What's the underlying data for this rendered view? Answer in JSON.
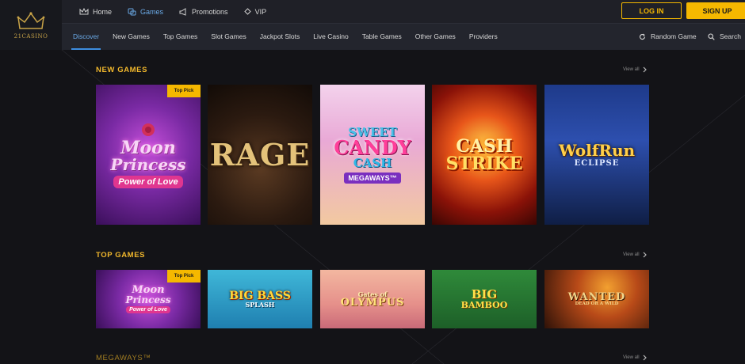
{
  "brand": {
    "logo_text": "21CASINO"
  },
  "topnav": [
    {
      "label": "Home",
      "icon": "crown-icon",
      "active": false
    },
    {
      "label": "Games",
      "icon": "dice-icon",
      "active": true
    },
    {
      "label": "Promotions",
      "icon": "megaphone-icon",
      "active": false
    },
    {
      "label": "VIP",
      "icon": "diamond-icon",
      "active": false
    }
  ],
  "auth": {
    "login_label": "LOG IN",
    "signup_label": "SIGN UP"
  },
  "subnav": [
    {
      "label": "Discover",
      "active": true
    },
    {
      "label": "New Games",
      "active": false
    },
    {
      "label": "Top Games",
      "active": false
    },
    {
      "label": "Slot Games",
      "active": false
    },
    {
      "label": "Jackpot Slots",
      "active": false
    },
    {
      "label": "Live Casino",
      "active": false
    },
    {
      "label": "Table Games",
      "active": false
    },
    {
      "label": "Other Games",
      "active": false
    },
    {
      "label": "Providers",
      "active": false
    }
  ],
  "tools": {
    "random_label": "Random Game",
    "search_label": "Search"
  },
  "sections": [
    {
      "title": "NEW GAMES",
      "view_all": "View all",
      "games": [
        {
          "line1": "Moon",
          "line2": "Princess",
          "line3": "Power of Love",
          "badge": "Top Pick"
        },
        {
          "line1": "RAGE",
          "line2": "",
          "line3": "",
          "badge": ""
        },
        {
          "line1": "SWEET",
          "line2": "CANDY",
          "line3": "CASH",
          "line4": "MEGAWAYS™",
          "badge": ""
        },
        {
          "line1": "CASH",
          "line2": "STRIKE",
          "line3": "",
          "badge": ""
        },
        {
          "line1": "WolfRun",
          "line2": "ECLIPSE",
          "line3": "",
          "badge": ""
        }
      ]
    },
    {
      "title": "TOP GAMES",
      "view_all": "View all",
      "games": [
        {
          "line1": "Moon",
          "line2": "Princess",
          "line3": "Power of Love",
          "badge": "Top Pick"
        },
        {
          "line1": "BIG BASS",
          "line2": "SPLASH",
          "line3": "",
          "badge": ""
        },
        {
          "line1": "Gates of",
          "line2": "OLYMPUS",
          "line3": "",
          "badge": ""
        },
        {
          "line1": "BIG",
          "line2": "BAMBOO",
          "line3": "",
          "badge": ""
        },
        {
          "line1": "WANTED",
          "line2": "DEAD OR A WILD",
          "line3": "",
          "badge": ""
        }
      ]
    },
    {
      "title": "MEGAWAYS™",
      "view_all": "View all"
    }
  ],
  "colors": {
    "accent": "#f5b800",
    "link_active": "#6aa9e6",
    "bg": "#131317"
  }
}
